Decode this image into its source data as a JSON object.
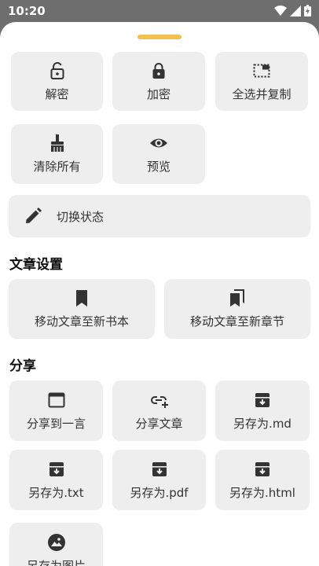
{
  "status_bar": {
    "time": "10:20",
    "icons": [
      "wifi-icon",
      "signal-icon",
      "battery-icon"
    ]
  },
  "sheet": {
    "handle_color": "#f2c14e",
    "edit_actions": [
      {
        "icon": "unlock-icon",
        "label": "解密"
      },
      {
        "icon": "lock-icon",
        "label": "加密"
      },
      {
        "icon": "select-all-icon",
        "label": "全选并复制"
      },
      {
        "icon": "clean-icon",
        "label": "清除所有"
      },
      {
        "icon": "eye-icon",
        "label": "预览"
      }
    ],
    "toggle_state": {
      "icon": "pencil-icon",
      "label": "切换状态"
    },
    "article_settings": {
      "title": "文章设置",
      "actions": [
        {
          "icon": "bookmark-icon",
          "label": "移动文章至新书本"
        },
        {
          "icon": "bookmarks-icon",
          "label": "移动文章至新章节"
        }
      ]
    },
    "share": {
      "title": "分享",
      "actions": [
        {
          "icon": "window-icon",
          "label": "分享到一言"
        },
        {
          "icon": "link-add-icon",
          "label": "分享文章"
        },
        {
          "icon": "archive-icon",
          "label": "另存为.md"
        },
        {
          "icon": "archive-icon",
          "label": "另存为.txt"
        },
        {
          "icon": "archive-icon",
          "label": "另存为.pdf"
        },
        {
          "icon": "archive-icon",
          "label": "另存为.html"
        },
        {
          "icon": "image-icon",
          "label": "另存为图片"
        }
      ]
    }
  }
}
